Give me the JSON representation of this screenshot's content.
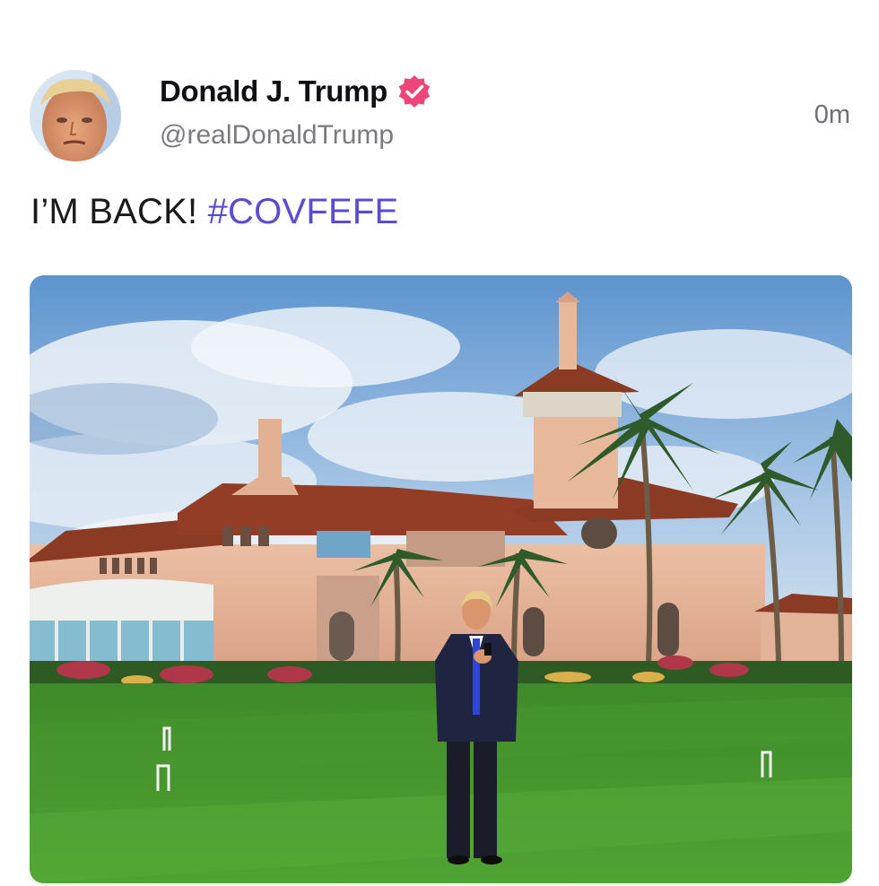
{
  "post": {
    "author": {
      "display_name": "Donald J. Trump",
      "handle": "@realDonaldTrump",
      "verified": true,
      "verified_badge_color": "#f0457a",
      "avatar_icon": "profile-photo"
    },
    "timestamp": "0m",
    "text_main": "I’M BACK!",
    "hashtag": "#COVFEFE",
    "hashtag_color": "#5a4bd6",
    "media": {
      "kind": "photo"
    }
  }
}
